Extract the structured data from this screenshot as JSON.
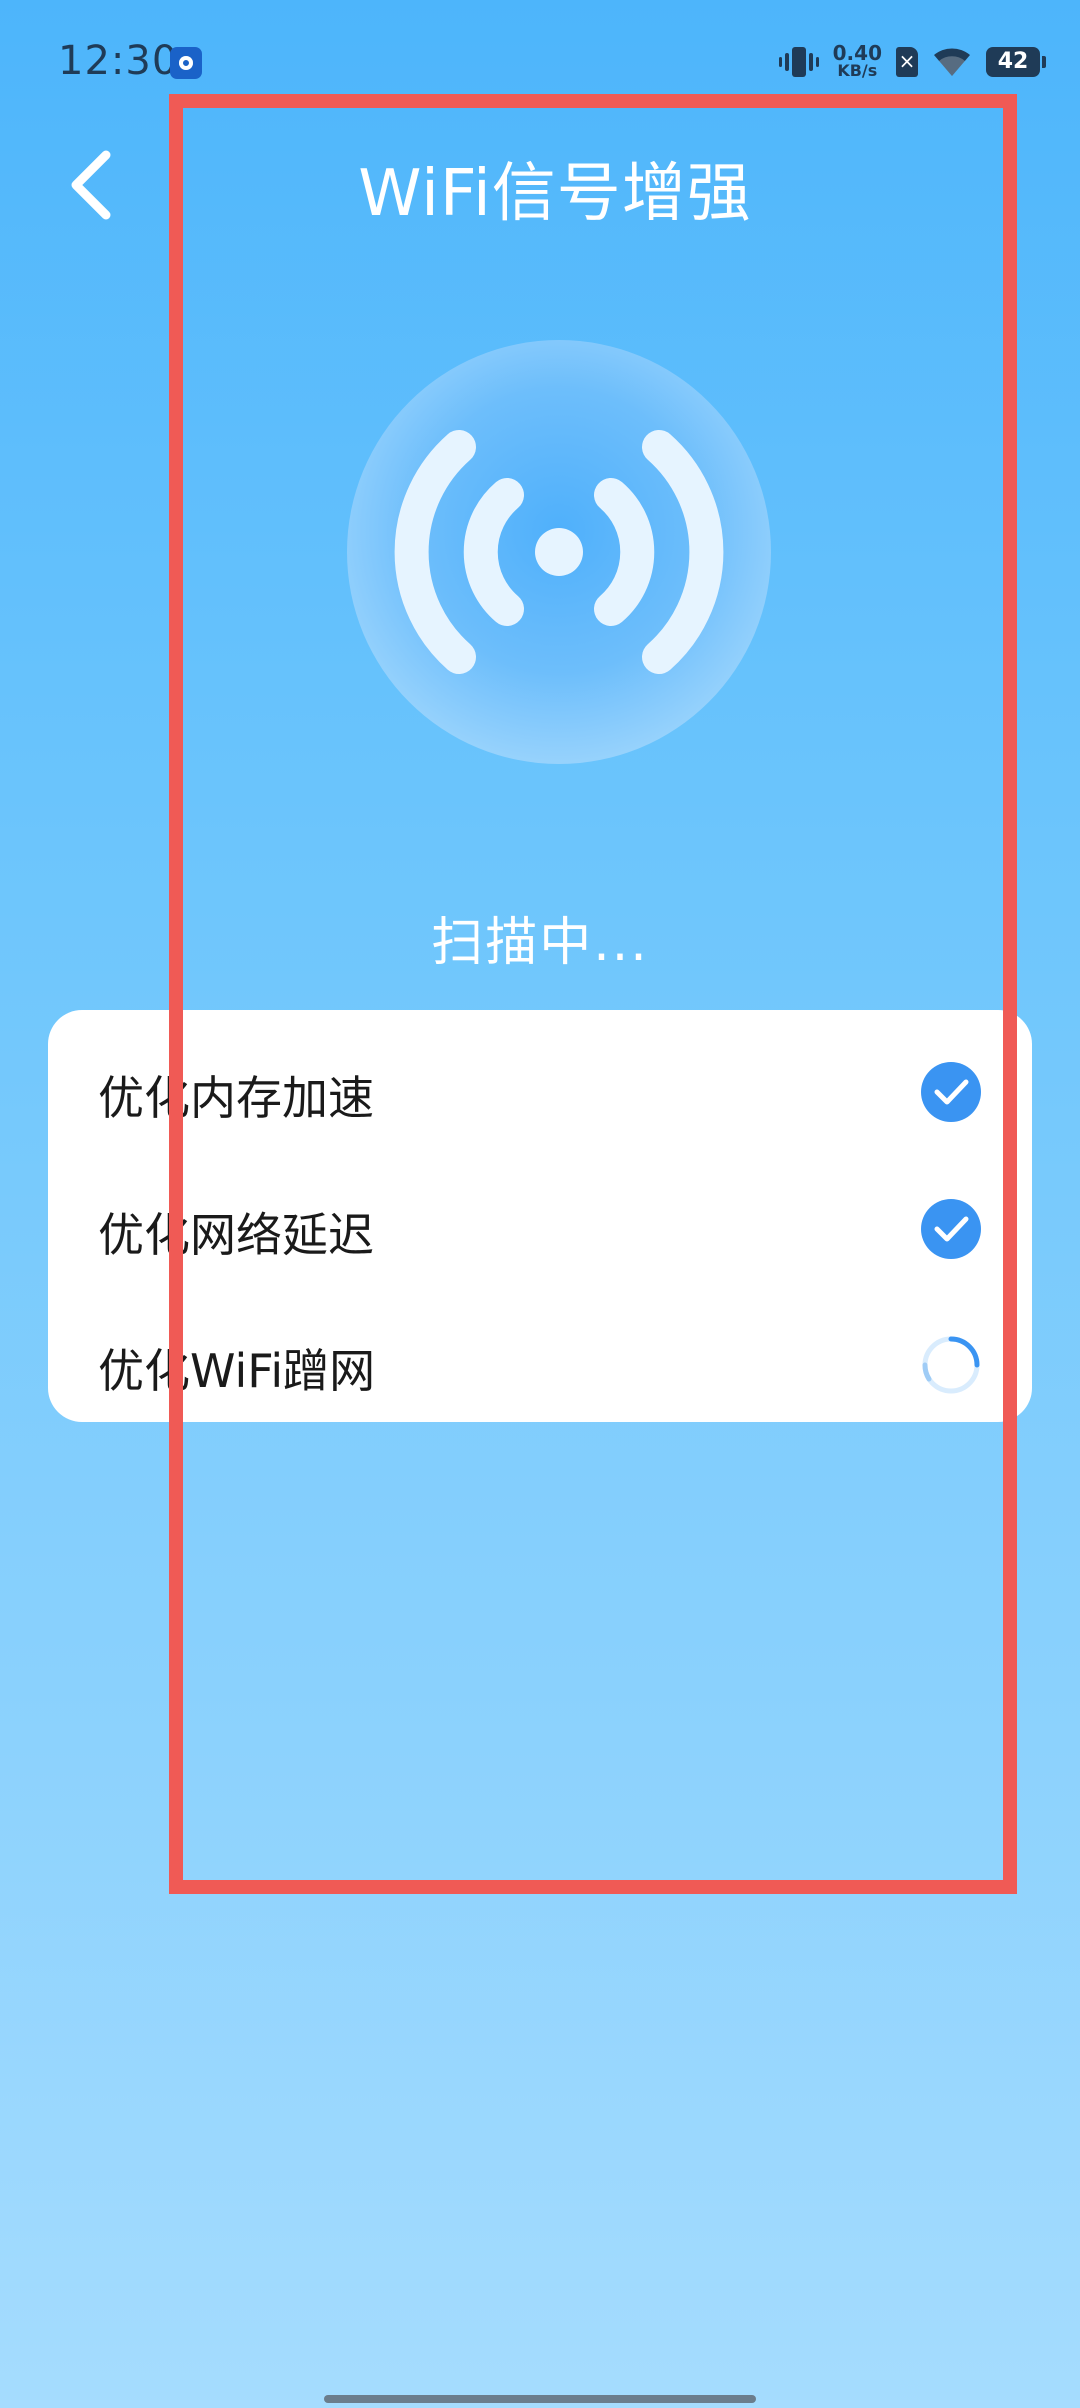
{
  "status_bar": {
    "time": "12:30",
    "net_speed_value": "0.40",
    "net_speed_unit": "KB/s",
    "battery_level": "42"
  },
  "header": {
    "title": "WiFi信号增强"
  },
  "scan": {
    "status_text": "扫描中..."
  },
  "tasks": [
    {
      "label": "优化内存加速",
      "state": "done"
    },
    {
      "label": "优化网络延迟",
      "state": "done"
    },
    {
      "label": "优化WiFi蹭网",
      "state": "in-progress"
    }
  ],
  "colors": {
    "accent": "#3a94f2",
    "annotation": "#f05a55"
  }
}
